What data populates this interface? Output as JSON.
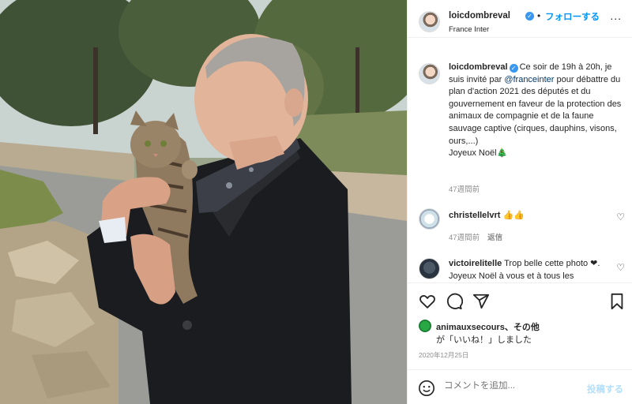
{
  "post": {
    "photo_alt": "",
    "header": {
      "username": "loicdombreval",
      "verified_mark": "✓",
      "separator": "•",
      "follow_label": "フォローする",
      "location": "France Inter",
      "more_label": "..."
    },
    "caption": {
      "username": "loicdombreval",
      "verified_mark": "✓",
      "text_part1": "Ce soir de 19h à 20h, je suis invité par ",
      "mention": "@franceinter",
      "text_part2": " pour débattre du plan d'action 2021 des députés et du gouvernement en faveur de la protection des animaux de compagnie et de la faune sauvage captive (cirques, dauphins, visons, ours,...)",
      "text_part3": "Joyeux Noël",
      "emoji": "🎄",
      "time": "47週間前"
    },
    "comments": [
      {
        "username": "christellelvrt",
        "text": "👍👍",
        "time": "47週間前",
        "reply_label": "返信"
      },
      {
        "username": "victoirelitelle",
        "text": "Trop belle cette photo ❤. Joyeux Noël à vous et à tous les"
      }
    ],
    "actions": {
      "like_icon": "heart-icon",
      "comment_icon": "comment-icon",
      "share_icon": "share-icon",
      "save_icon": "bookmark-icon"
    },
    "likes": {
      "username": "animauxsecours",
      "suffix": "、その他",
      "line2": "が「いいね！」しました"
    },
    "date": "2020年12月25日",
    "add_comment": {
      "placeholder": "コメントを追加...",
      "post_label": "投稿する"
    }
  }
}
